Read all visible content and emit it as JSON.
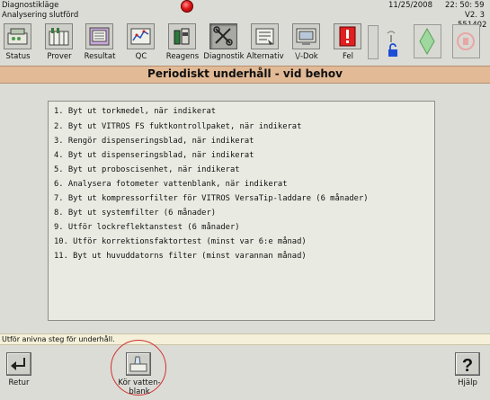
{
  "status": {
    "mode": "Diagnostikläge",
    "sub": "Analysering slutförd",
    "date": "11/25/2008",
    "time": "22: 50: 59",
    "version": "V2. 3",
    "serial": "551402"
  },
  "toolbar": [
    {
      "label": "Status",
      "icon": "status-icon"
    },
    {
      "label": "Prover",
      "icon": "samples-icon"
    },
    {
      "label": "Resultat",
      "icon": "results-icon"
    },
    {
      "label": "QC",
      "icon": "qc-icon"
    },
    {
      "label": "Reagens",
      "icon": "reagents-icon"
    },
    {
      "label": "Diagnostik",
      "icon": "diagnostics-icon"
    },
    {
      "label": "Alternativ",
      "icon": "options-icon"
    },
    {
      "label": "\\/-Dok",
      "icon": "document-icon"
    },
    {
      "label": "Fel",
      "icon": "error-icon"
    }
  ],
  "page": {
    "title": "Periodiskt underhåll - vid behov"
  },
  "tasks": [
    "1. Byt ut torkmedel, när indikerat",
    "2. Byt ut VITROS FS fuktkontrollpaket, när indikerat",
    "3. Rengör dispenseringsblad, när indikerat",
    "4. Byt ut dispenseringsblad, när indikerat",
    "5. Byt ut proboscisenhet, när indikerat",
    "6. Analysera fotometer vattenblank, när indikerat",
    "7. Byt ut kompressorfilter för VITROS VersaTip-laddare (6 månader)",
    "8. Byt ut systemfilter (6 månader)",
    "9. Utför lockreflektanstest (6 månader)",
    "10. Utför korrektionsfaktortest (minst var 6:e månad)",
    "11. Byt ut huvuddatorns filter (minst varannan månad)"
  ],
  "status_bar": {
    "message": "Utför anivna steg för underhåll."
  },
  "bottom": {
    "return_label": "Retur",
    "water_label_1": "Kör vatten-",
    "water_label_2": "blank",
    "help_label": "Hjälp"
  },
  "colors": {
    "header_band": "#e2ba96",
    "alert": "#e01818",
    "lock": "#1a4fd6",
    "circle": "#d03030"
  }
}
